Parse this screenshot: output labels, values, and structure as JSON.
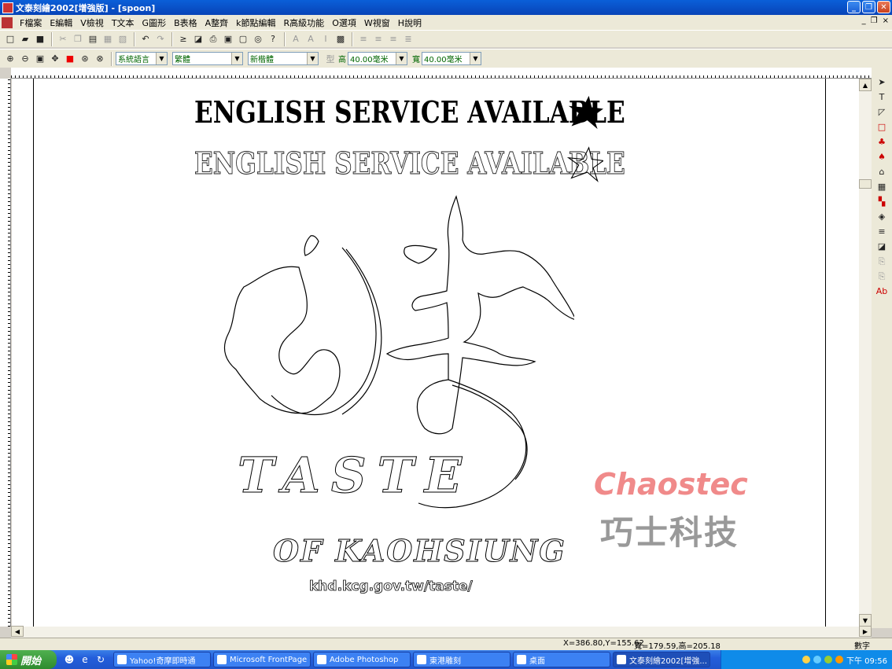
{
  "window": {
    "title": "文泰刻繪2002[增強版] - [spoon]",
    "buttons": [
      "_",
      "❐",
      "✕"
    ]
  },
  "menu": {
    "items": [
      "F檔案",
      "E編輯",
      "V檢視",
      "T文本",
      "G圖形",
      "B表格",
      "A整齊",
      "k節點編輯",
      "R高級功能",
      "O選項",
      "W視窗",
      "H說明"
    ],
    "right": [
      "_",
      "❐",
      "×"
    ]
  },
  "toolbar2": {
    "lang": "系統語言",
    "charset": "繁體",
    "font": "新楷體",
    "height_label": "高",
    "height_value": "40.00毫米",
    "width_label": "寬",
    "width_value": "40.00毫米"
  },
  "canvas": {
    "headline1": "ENGLISH SERVICE AVAILABLE",
    "headline2": "ENGLISH SERVICE AVAILABLE",
    "taste": "TASTE",
    "of_kaohsiung": "OF KAOHSIUNG",
    "url": "khd.kcg.gov.tw/taste/",
    "watermark_brand": "Chaostec",
    "watermark_cn": "巧士科技"
  },
  "status": {
    "coords": "X=386.80,Y=155.62",
    "dims": "寬=179.59,高=205.18",
    "mode": "數字"
  },
  "taskbar": {
    "start": "開始",
    "tasks": [
      "Yahoo!奇摩即時通",
      "Microsoft FrontPage -...",
      "Adobe Photoshop",
      "東港雕刻",
      "桌面",
      "文泰刻繪2002[增強..."
    ],
    "clock": "下午 09:56"
  },
  "colors": {
    "titlebar": "#0a5fd8",
    "watermark_red": "#f08a8a",
    "watermark_gray": "#999999"
  }
}
